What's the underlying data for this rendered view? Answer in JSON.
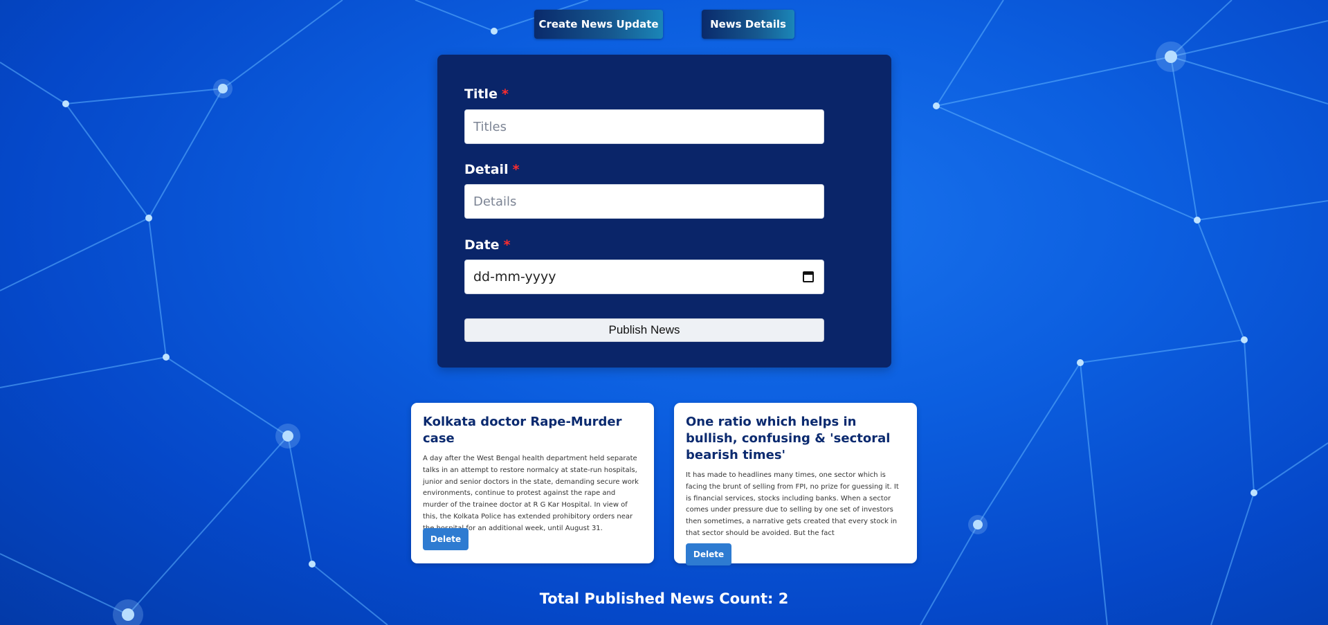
{
  "nav": {
    "create_label": "Create News Update",
    "details_label": "News Details"
  },
  "form": {
    "title_label": "Title",
    "title_placeholder": "Titles",
    "detail_label": "Detail",
    "detail_placeholder": "Details",
    "date_label": "Date",
    "date_placeholder": "dd-mm-yyyy",
    "required_mark": "*",
    "publish_label": "Publish News"
  },
  "news": [
    {
      "title": "Kolkata doctor Rape-Murder case",
      "detail": "A day after the West Bengal health department held separate talks in an attempt to restore normalcy at state-run hospitals, junior and senior doctors in the state, demanding secure work environments, continue to protest against the rape and murder of the trainee doctor at R G Kar Hospital. In view of this, the Kolkata Police has extended prohibitory orders near the hospital for an additional week, until August 31.",
      "delete_label": "Delete"
    },
    {
      "title": "One ratio which helps in bullish, confusing & 'sectoral bearish times'",
      "detail": "It has made to headlines many times, one sector which is facing the brunt of selling from FPI, no prize for guessing it. It is financial services, stocks including banks. When a sector comes under pressure due to selling by one set of investors then sometimes, a narrative gets created that every stock in that sector should be avoided. But the fact",
      "delete_label": "Delete"
    }
  ],
  "footer": {
    "total_text": "Total Published News Count: 2"
  },
  "colors": {
    "background": "#0c5fe0",
    "form_card": "#0a2569",
    "required": "#ff2d2d",
    "delete_button": "#2e7bd1",
    "news_title": "#0b2a6f"
  }
}
